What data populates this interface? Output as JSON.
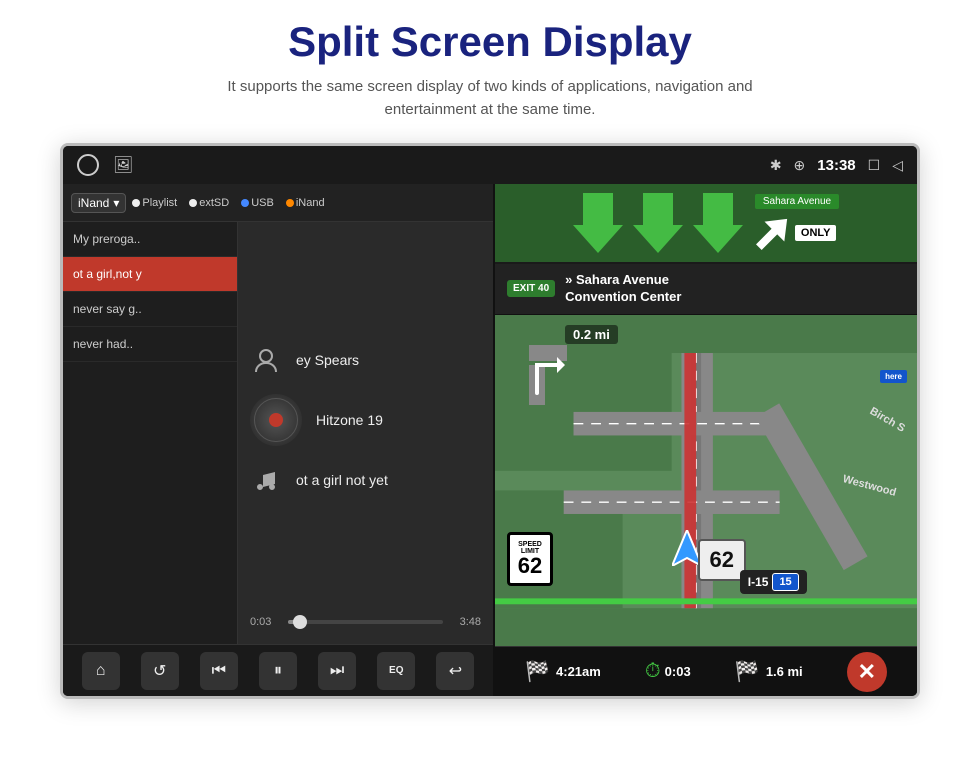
{
  "header": {
    "title": "Split Screen Display",
    "subtitle": "It supports the same screen display of two kinds of applications, navigation and entertainment at the same time."
  },
  "status_bar": {
    "time": "13:38",
    "bluetooth_icon": "✱",
    "location_icon": "⊕",
    "window_icon": "☐",
    "back_icon": "◁"
  },
  "music": {
    "source_dropdown": "iNand",
    "tabs": [
      "Playlist",
      "extSD",
      "USB",
      "iNand"
    ],
    "playlist": [
      {
        "label": "My preroga..",
        "active": false
      },
      {
        "label": "ot a girl,not y",
        "active": true
      },
      {
        "label": "never say g..",
        "active": false
      },
      {
        "label": "never had..",
        "active": false
      }
    ],
    "artist": "ey Spears",
    "album": "Hitzone 19",
    "track": "ot a girl not yet",
    "time_current": "0:03",
    "time_total": "3:48",
    "progress_pct": 8
  },
  "controls": {
    "home": "⌂",
    "repeat": "↺",
    "prev": "⏮",
    "play_pause": "⏸",
    "next": "⏭",
    "eq": "EQ",
    "back": "↩"
  },
  "navigation": {
    "exit_badge": "EXIT 40",
    "instruction_main": "» Sahara Avenue",
    "instruction_sub": "Convention Center",
    "road_labels": [
      "Birch S",
      "Westwood"
    ],
    "speed_display": "62",
    "highway_label": "I-15",
    "highway_shield": "15",
    "distance_top": "0.2 mi",
    "distance_bottom": "1.6 mi",
    "eta": "4:21am",
    "eta_duration": "0:03",
    "only_sign": "ONLY",
    "limit_label": "SPEED\nLIMIT",
    "limit_num": "62"
  }
}
